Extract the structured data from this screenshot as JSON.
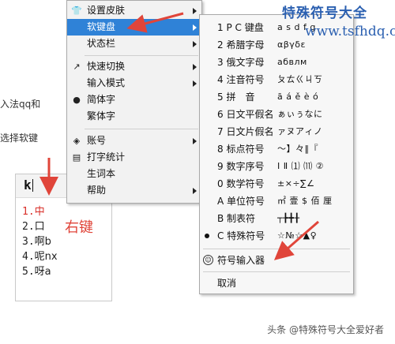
{
  "document": {
    "line1": "入法qq和",
    "line2": "选择软键"
  },
  "ime": {
    "input_text": "k",
    "candidates": [
      {
        "num": "1.",
        "text": "中",
        "active": true
      },
      {
        "num": "2.",
        "text": "口",
        "active": false
      },
      {
        "num": "3.",
        "text": "啊b",
        "active": false
      },
      {
        "num": "4.",
        "text": "呢nx",
        "active": false
      },
      {
        "num": "5.",
        "text": "呀a",
        "active": false
      }
    ],
    "annotation": "右键"
  },
  "main_menu": {
    "items": [
      {
        "label": "设置皮肤",
        "icon": "shirt-icon",
        "arrow": true
      },
      {
        "label": "软键盘",
        "icon": "",
        "arrow": true,
        "highlighted": true
      },
      {
        "label": "状态栏",
        "icon": "",
        "arrow": true
      },
      {
        "label": "快速切换",
        "icon": "switch-icon",
        "arrow": true
      },
      {
        "label": "输入模式",
        "icon": "",
        "arrow": true
      },
      {
        "label": "简体字",
        "icon": "bullet-icon",
        "arrow": false
      },
      {
        "label": "繁体字",
        "icon": "",
        "arrow": false
      },
      {
        "label": "账号",
        "icon": "account-icon",
        "arrow": true
      },
      {
        "label": "打字统计",
        "icon": "stats-icon",
        "arrow": false
      },
      {
        "label": "生词本",
        "icon": "",
        "arrow": false
      },
      {
        "label": "帮助",
        "icon": "",
        "arrow": true
      }
    ]
  },
  "soft_keyboard_menu": {
    "items": [
      {
        "label": "1 P C 键盘",
        "sample": "a s d f g"
      },
      {
        "label": "2 希腊字母",
        "sample": "αβγδε"
      },
      {
        "label": "3 俄文字母",
        "sample": "абвлм"
      },
      {
        "label": "4 注音符号",
        "sample": "ㄆㄊㄍㄐㄎ"
      },
      {
        "label": "5 拼　音",
        "sample": "ā á ě è ó"
      },
      {
        "label": "6 日文平假名",
        "sample": "ぁぃぅなに"
      },
      {
        "label": "7 日文片假名",
        "sample": "ァヌアィノ"
      },
      {
        "label": "8 标点符号",
        "sample": "～】々‖『"
      },
      {
        "label": "9 数字序号",
        "sample": "Ⅰ Ⅱ ⑴ ⑾ ②"
      },
      {
        "label": "0 数学符号",
        "sample": "±×÷∑∠"
      },
      {
        "label": "A 单位符号",
        "sample": "㎡ 壹 $ 佰 厘"
      },
      {
        "label": "B 制表符",
        "sample": "┬╊╋╂"
      },
      {
        "label": "C 特殊符号",
        "sample": "☆№☆▲♀",
        "selected": true
      },
      {
        "label": "符号输入器",
        "icon": "smiley-icon"
      },
      {
        "label": "取消"
      }
    ]
  },
  "watermark": {
    "title": "特殊符号大全",
    "url": "www.tsfhdq.cn"
  },
  "footer": {
    "credit": "头条 @特殊符号大全爱好者"
  },
  "colors": {
    "highlight": "#2f82d7",
    "arrow_red": "#e0453a",
    "watermark_blue": "#2a5fb0"
  }
}
